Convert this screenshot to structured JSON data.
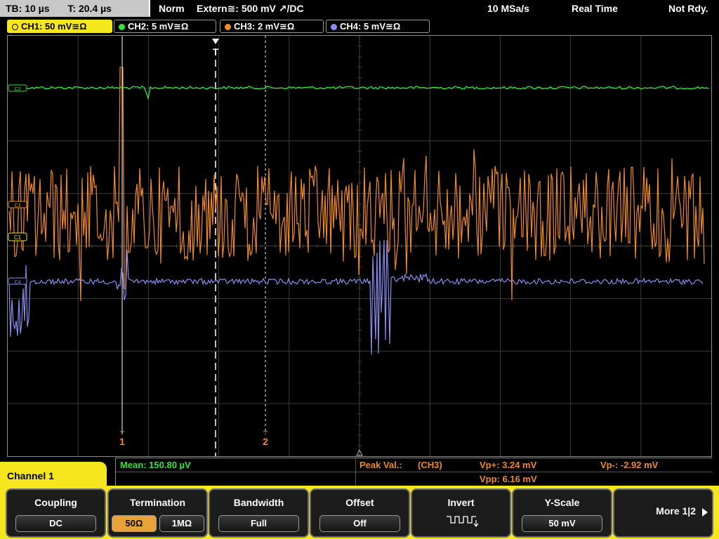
{
  "topbar": {
    "timebase": "TB: 10 µs",
    "trigger_time": "T: 20.4 µs",
    "mode": "Norm",
    "trigger": "Extern≅: 500 mV ↗/DC",
    "sample_rate": "10 MSa/s",
    "acq_mode": "Real Time",
    "status": "Not Rdy."
  },
  "channels": [
    {
      "label": "CH1: 50 mV≅Ω",
      "color": "#f5e61e",
      "active": true
    },
    {
      "label": "CH2: 5 mV≅Ω",
      "color": "#35e33a",
      "active": false
    },
    {
      "label": "CH3: 2 mV≅Ω",
      "color": "#f08a28",
      "active": false
    },
    {
      "label": "CH4: 5 mV≅Ω",
      "color": "#8c8cf0",
      "active": false
    }
  ],
  "markers": {
    "trigger": "T",
    "cursor1": "1",
    "cursor2": "2"
  },
  "waveform_labels": {
    "ch1": "C1",
    "ch2": "C2",
    "ch3": "C3",
    "ch4": "C4"
  },
  "measurements": {
    "mean": "Mean: 150.80 µV",
    "peak_title": "Peak Val.:",
    "peak_source": "(CH3)",
    "vp_plus": "Vp+: 3.24 mV",
    "vp_minus": "Vp-: -2.92 mV",
    "vpp": "Vpp: 6.16 mV"
  },
  "menu": {
    "title": "Channel 1",
    "coupling": {
      "title": "Coupling",
      "value": "DC"
    },
    "termination": {
      "title": "Termination",
      "option_a": "50Ω",
      "option_b": "1MΩ",
      "selected": "50Ω"
    },
    "bandwidth": {
      "title": "Bandwidth",
      "value": "Full"
    },
    "offset": {
      "title": "Offset",
      "value": "Off"
    },
    "invert": {
      "title": "Invert",
      "icon": "invert-waveform-icon"
    },
    "yscale": {
      "title": "Y-Scale",
      "value": "50 mV"
    },
    "more": {
      "label": "More 1|2",
      "icon": "arrow-right-icon"
    }
  },
  "colors": {
    "ch1": "#f5e61e",
    "ch2": "#35e33a",
    "ch3": "#f08a28",
    "ch4": "#8c8cf0",
    "grid": "#3c3c3c"
  }
}
